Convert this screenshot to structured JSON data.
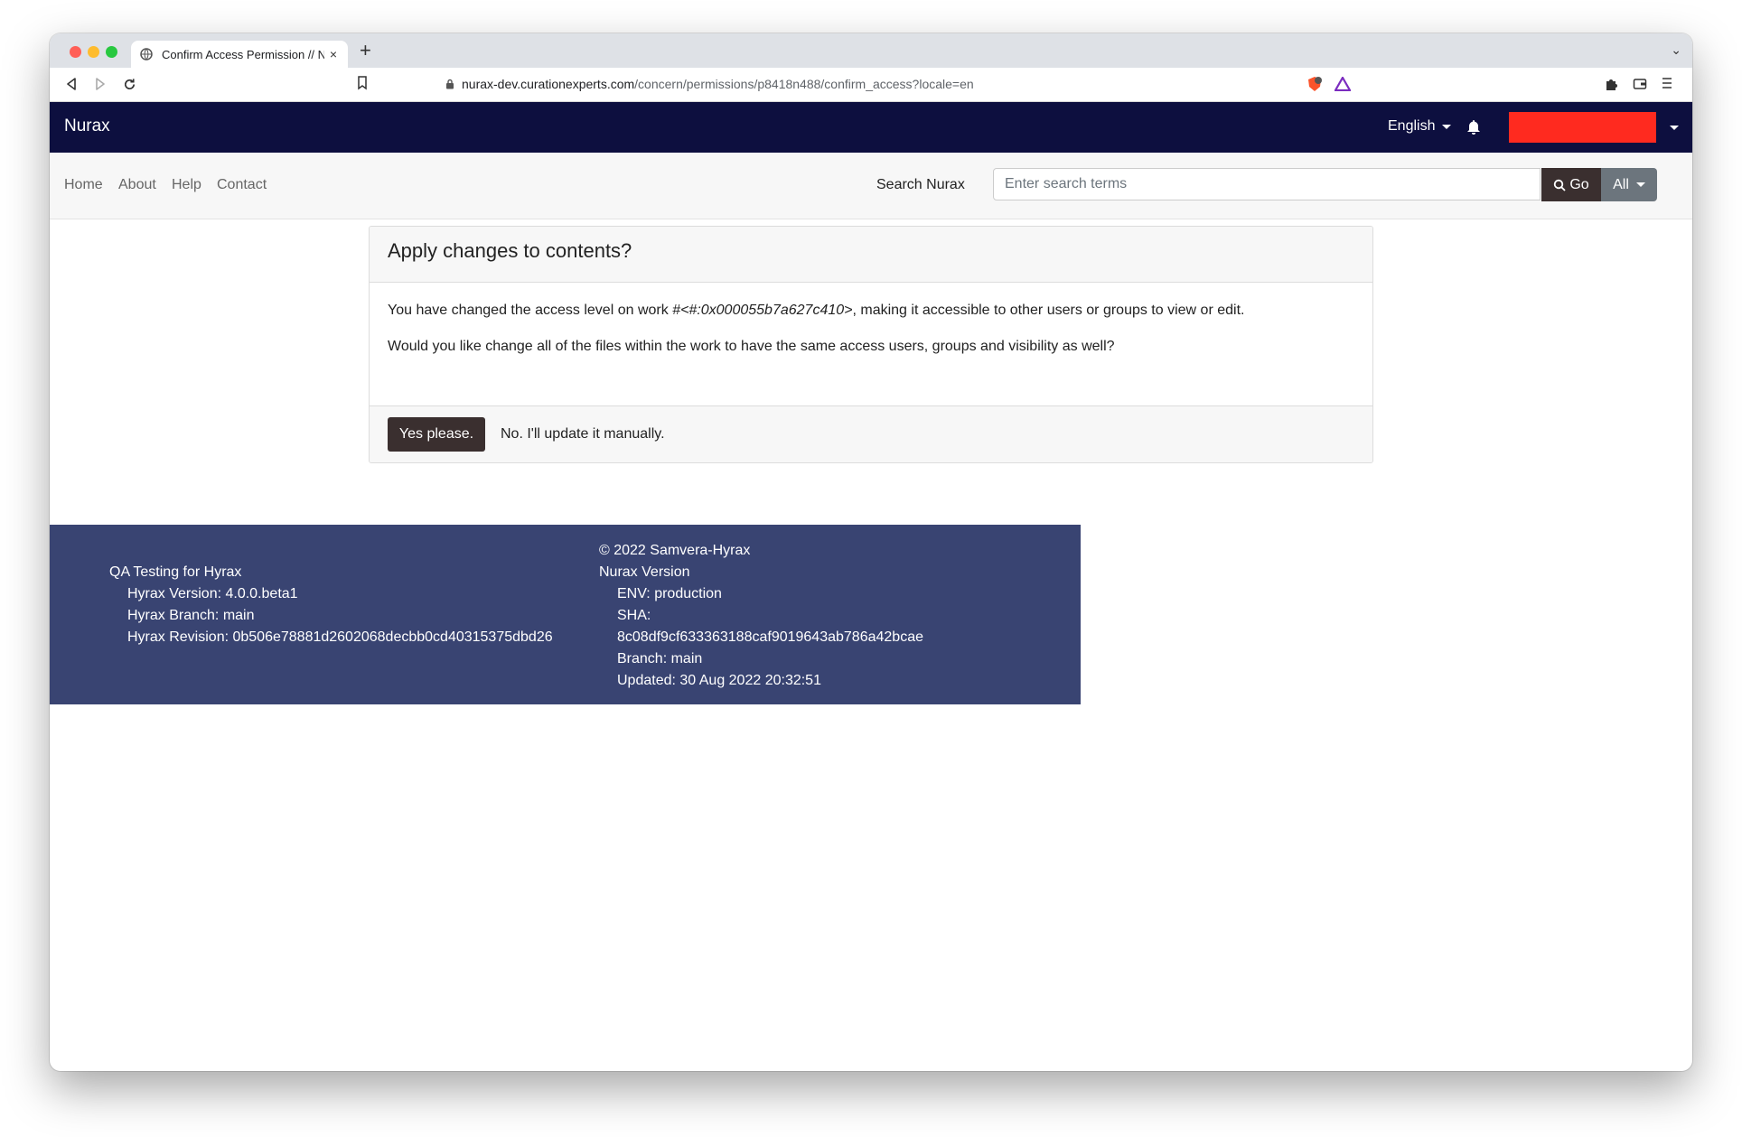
{
  "browser": {
    "tab_title": "Confirm Access Permission // N",
    "tab_close": "×",
    "new_tab": "+",
    "tab_menu": "⌄",
    "url_host": "nurax-dev.curationexperts.com",
    "url_path": "/concern/permissions/p8418n488/confirm_access?locale=en"
  },
  "header": {
    "brand": "Nurax",
    "language": "English"
  },
  "nav": {
    "links": [
      "Home",
      "About",
      "Help",
      "Contact"
    ],
    "search_label": "Search Nurax",
    "search_placeholder": "Enter search terms",
    "go_label": "Go",
    "scope_label": "All"
  },
  "dialog": {
    "title": "Apply changes to contents?",
    "message_before": "You have changed the access level on work ",
    "work_id": "#<#:0x000055b7a627c410>",
    "message_after": ", making it accessible to other users or groups to view or edit.",
    "question": "Would you like change all of the files within the work to have the same access users, groups and visibility as well?",
    "yes_label": "Yes please.",
    "no_label": "No. I'll update it manually."
  },
  "footer": {
    "left": {
      "heading": "QA Testing for Hyrax",
      "version": "Hyrax Version: 4.0.0.beta1",
      "branch": "Hyrax Branch: main",
      "revision": "Hyrax Revision: 0b506e78881d2602068decbb0cd40315375dbd26"
    },
    "right": {
      "copyright": "© 2022 Samvera-Hyrax",
      "heading": "Nurax Version",
      "env": "ENV: production",
      "sha_label": "SHA:",
      "sha": "8c08df9cf633363188caf9019643ab786a42bcae",
      "branch": "Branch: main",
      "updated": "Updated: 30 Aug 2022 20:32:51"
    }
  },
  "colors": {
    "navbar": "#0d0f3f",
    "footer": "#394472",
    "button_dark": "#3a2f2f",
    "redacted_user": "#ff2a1f"
  }
}
